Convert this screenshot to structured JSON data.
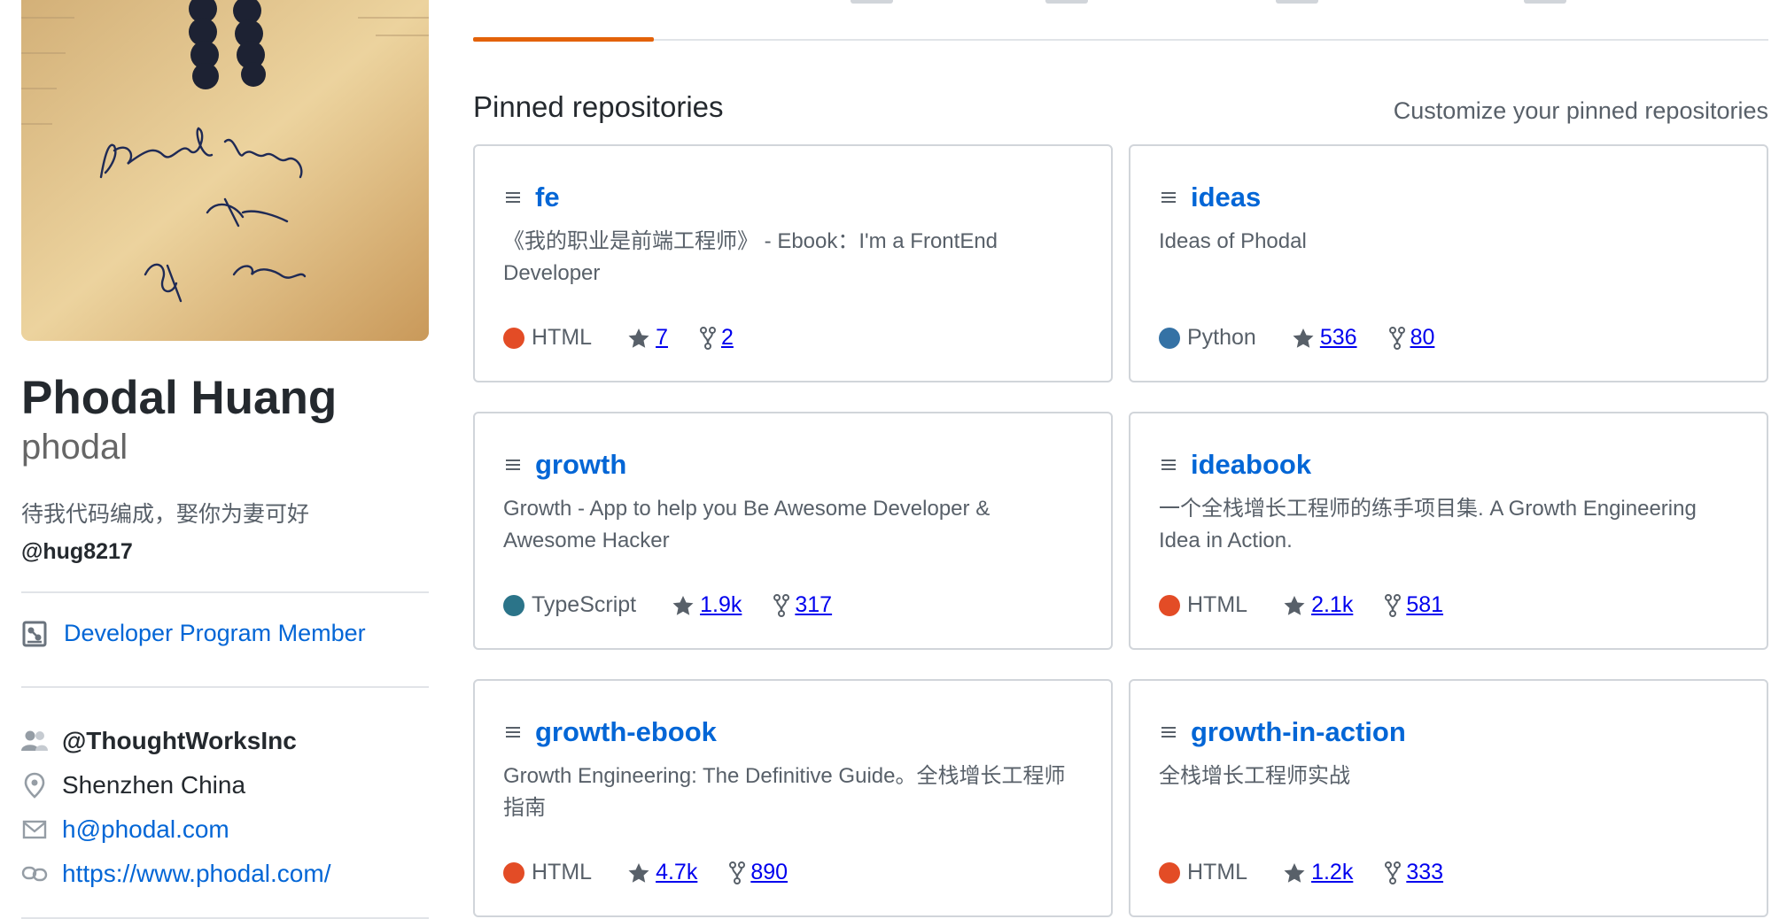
{
  "profile": {
    "full_name": "Phodal Huang",
    "login": "phodal",
    "bio": "待我代码编成，娶你为妻可好",
    "bio_handle": "@hug8217",
    "badge_label": "Developer Program Member",
    "organization": "@ThoughtWorksInc",
    "location": "Shenzhen China",
    "email": "h@phodal.com",
    "website": "https://www.phodal.com/"
  },
  "pinned": {
    "title": "Pinned repositories",
    "customize_label": "Customize your pinned repositories",
    "repos": [
      {
        "name": "fe",
        "description": "《我的职业是前端工程师》 - Ebook：I'm a FrontEnd Developer",
        "language": "HTML",
        "language_color": "#e34c26",
        "stars": "7",
        "forks": "2"
      },
      {
        "name": "ideas",
        "description": "Ideas of Phodal",
        "language": "Python",
        "language_color": "#3572A5",
        "stars": "536",
        "forks": "80"
      },
      {
        "name": "growth",
        "description": "Growth - App to help you Be Awesome Developer & Awesome Hacker",
        "language": "TypeScript",
        "language_color": "#2b7489",
        "stars": "1.9k",
        "forks": "317"
      },
      {
        "name": "ideabook",
        "description": "一个全栈增长工程师的练手项目集. A Growth Engineering Idea in Action.",
        "language": "HTML",
        "language_color": "#e34c26",
        "stars": "2.1k",
        "forks": "581"
      },
      {
        "name": "growth-ebook",
        "description": "Growth Engineering: The Definitive Guide。全栈增长工程师指南",
        "language": "HTML",
        "language_color": "#e34c26",
        "stars": "4.7k",
        "forks": "890"
      },
      {
        "name": "growth-in-action",
        "description": "全栈增长工程师实战",
        "language": "HTML",
        "language_color": "#e34c26",
        "stars": "1.2k",
        "forks": "333"
      }
    ]
  },
  "colors": {
    "link": "#0366d6",
    "active_tab": "#e36209",
    "border": "#d1d5da"
  },
  "icons": {
    "repo": "repo-icon",
    "star": "star-icon",
    "fork": "fork-icon",
    "badge": "developer-badge-icon",
    "organization": "organization-icon",
    "location": "location-icon",
    "email": "mail-icon",
    "link": "link-icon"
  }
}
